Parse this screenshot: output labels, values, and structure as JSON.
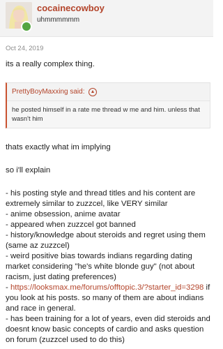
{
  "user": {
    "username": "cocainecowboy",
    "title": "uhmmmmmm"
  },
  "post": {
    "date": "Oct 24, 2019",
    "intro": "its a really complex thing.",
    "quote": {
      "author_said": "PrettyBoyMaxxing said:",
      "text": "he posted himself in a rate me thread w me and him. unless that wasn't him"
    },
    "line1": "thats exactly what im implying",
    "line2": "so i'll explain",
    "items": [
      "- his posting style and thread titles and his content are extremely similar to zuzzcel, like VERY similar",
      "- anime obsession, anime avatar",
      "- appeared when zuzzcel got banned",
      "- history/knowledge about steroids and regret using them (same az zuzzcel)",
      "- weird positive bias towards indians regarding dating market considering \"he's white blonde guy\" (not about racism, just dating preferences)"
    ],
    "item6_prefix": "- ",
    "item6_link": "https://looksmax.me/forums/offtopic.3/?starter_id=3298",
    "item6_rest": " if you look at his posts. so many of them are about indians and race in general.",
    "item7": "- has been training for a lot of years, even did steroids and doesnt know basic concepts of cardio and asks question on forum (zuzzcel used to do this)"
  },
  "colors": {
    "accent": "#b3442a",
    "online": "#54a540"
  },
  "icons": {
    "badge": "online-status-icon",
    "quote_jump": "arrow-up-circle-icon"
  }
}
